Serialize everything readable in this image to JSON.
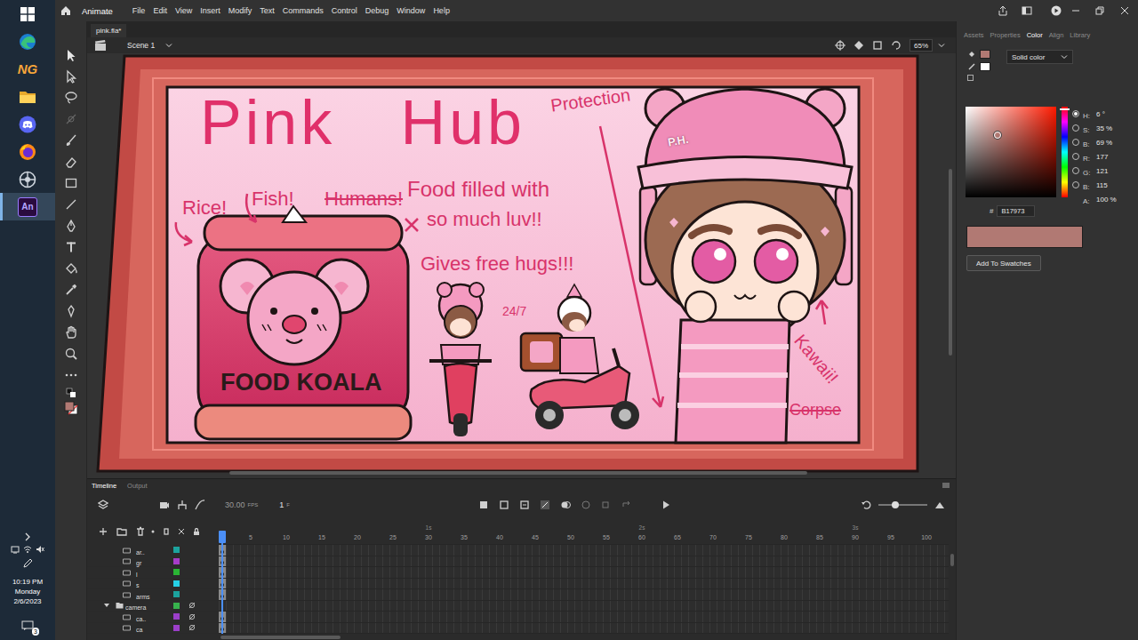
{
  "taskbar": {
    "apps": [
      {
        "label": "NG",
        "selected": false
      },
      {
        "label": "An",
        "selected": true
      }
    ],
    "time": "10:19 PM",
    "day": "Monday",
    "date": "2/6/2023",
    "notifications": "3"
  },
  "app": {
    "name": "Animate",
    "menus": [
      "File",
      "Edit",
      "View",
      "Insert",
      "Modify",
      "Text",
      "Commands",
      "Control",
      "Debug",
      "Window",
      "Help"
    ]
  },
  "document": {
    "tab": "pink.fla*",
    "scene": "Scene 1",
    "zoom": "65%"
  },
  "artwork": {
    "title": "Pink Hub",
    "notes": [
      {
        "text": "Rice!",
        "struck": false
      },
      {
        "text": "Fish!",
        "struck": false
      },
      {
        "text": "Humans!",
        "struck": true
      },
      {
        "text": "Food filled with",
        "struck": false
      },
      {
        "text": "so much luv!!",
        "struck": false
      },
      {
        "text": "Gives free hugs!!!",
        "struck": false
      },
      {
        "text": "24/7",
        "struck": false
      },
      {
        "text": "Protection",
        "struck": false
      },
      {
        "text": "Kawaii!",
        "struck": false
      },
      {
        "text": "Corpse",
        "struck": true
      }
    ],
    "logo": "FOOD KOALA",
    "badge": "P.H."
  },
  "color_panel": {
    "tabs": [
      {
        "label": "Assets",
        "selected": false
      },
      {
        "label": "Properties",
        "selected": false
      },
      {
        "label": "Color",
        "selected": true
      },
      {
        "label": "Align",
        "selected": false
      },
      {
        "label": "Library",
        "selected": false
      }
    ],
    "fill_type": "Solid color",
    "fields": [
      {
        "label": "H:",
        "value": "6 °",
        "kind": "radio",
        "selected": true
      },
      {
        "label": "S:",
        "value": "35 %",
        "kind": "radio",
        "selected": false
      },
      {
        "label": "B:",
        "value": "69 %",
        "kind": "radio",
        "selected": false
      },
      {
        "label": "R:",
        "value": "177",
        "kind": "radio",
        "selected": false
      },
      {
        "label": "G:",
        "value": "121",
        "kind": "radio",
        "selected": false
      },
      {
        "label": "B:",
        "value": "115",
        "kind": "radio",
        "selected": false
      },
      {
        "label": "A:",
        "value": "100 %",
        "kind": "plain",
        "selected": false
      }
    ],
    "picker": {
      "saturation": 0.35,
      "brightness": 0.69,
      "hue": 0.017
    },
    "hex_label": "#",
    "hex": "B17973",
    "color": "#b17973",
    "button": "Add To Swatches"
  },
  "timeline": {
    "tabs": [
      {
        "label": "Timeline",
        "selected": true
      },
      {
        "label": "Output",
        "selected": false
      }
    ],
    "fps": "30.00",
    "fps_unit": "FPS",
    "frame": "1",
    "frame_unit": "F",
    "zoom_level": 0.35,
    "seconds": [
      "1s",
      "2s",
      "3s"
    ],
    "ruler": [
      "5",
      "10",
      "15",
      "20",
      "25",
      "30",
      "35",
      "40",
      "45",
      "50",
      "55",
      "60",
      "65",
      "70",
      "75",
      "80",
      "85",
      "90",
      "95",
      "100"
    ],
    "layers": [
      {
        "name": "ar..",
        "color": "#1ca39e",
        "kind": "layer",
        "hidden": false,
        "expanded": false
      },
      {
        "name": "gr",
        "color": "#a63cc8",
        "kind": "layer",
        "hidden": false,
        "expanded": false
      },
      {
        "name": "l",
        "color": "#2ab534",
        "kind": "layer",
        "hidden": false,
        "expanded": false
      },
      {
        "name": "s",
        "color": "#26d0e6",
        "kind": "layer",
        "hidden": false,
        "expanded": false
      },
      {
        "name": "arms",
        "color": "#1ca39e",
        "kind": "layer",
        "hidden": false,
        "expanded": false
      },
      {
        "name": "camera",
        "color": "#37b24d",
        "kind": "folder",
        "hidden": true,
        "expanded": true
      },
      {
        "name": "ca..",
        "color": "#9b3fc9",
        "kind": "layer",
        "hidden": true,
        "expanded": false
      },
      {
        "name": "ca",
        "color": "#9b3fc9",
        "kind": "layer",
        "hidden": true,
        "expanded": false
      }
    ]
  }
}
